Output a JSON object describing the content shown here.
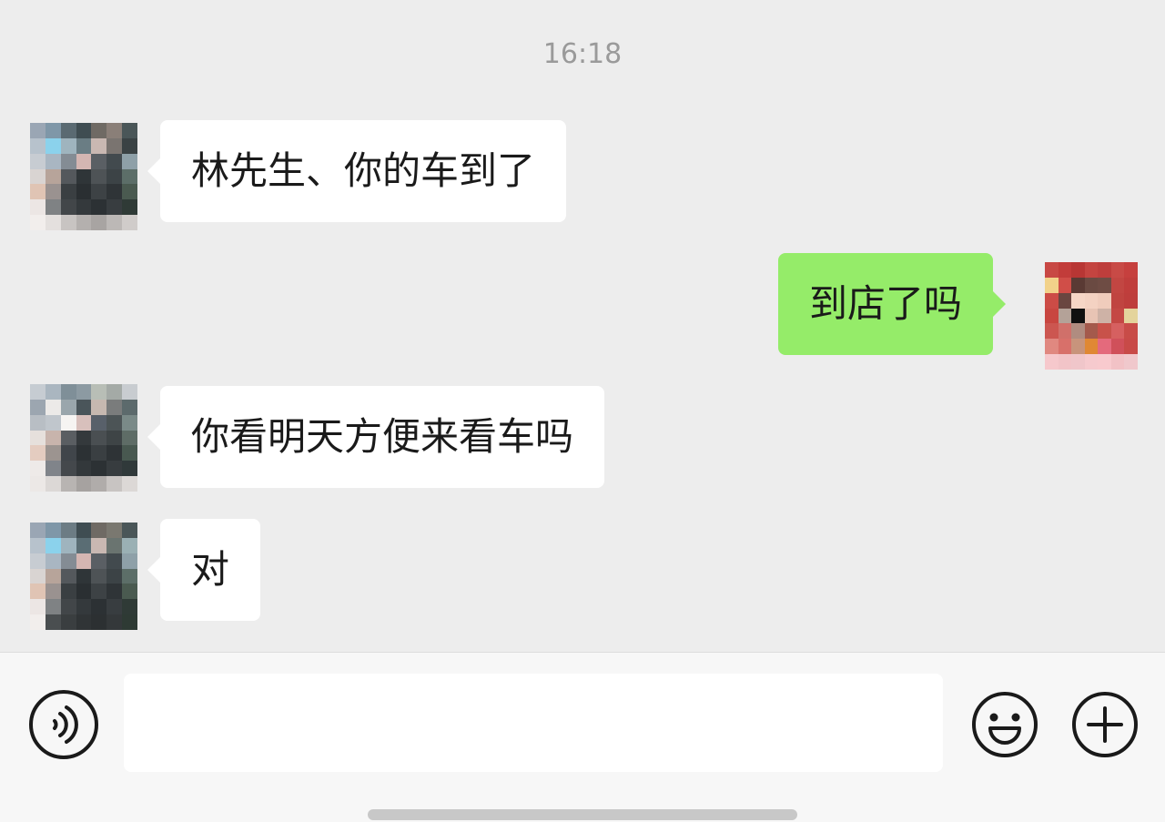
{
  "chat": {
    "timestamp": "16:18",
    "messages": [
      {
        "direction": "in",
        "text": "林先生、你的车到了"
      },
      {
        "direction": "out",
        "text": "到店了吗"
      },
      {
        "direction": "in",
        "text": "你看明天方便来看车吗"
      },
      {
        "direction": "in",
        "text": "对"
      }
    ]
  },
  "input_bar": {
    "voice_icon": "voice-icon",
    "text_value": "",
    "emoji_icon": "smiley-icon",
    "plus_icon": "plus-circle-icon"
  },
  "colors": {
    "background": "#ededed",
    "incoming_bubble": "#ffffff",
    "outgoing_bubble": "#95ec69"
  }
}
